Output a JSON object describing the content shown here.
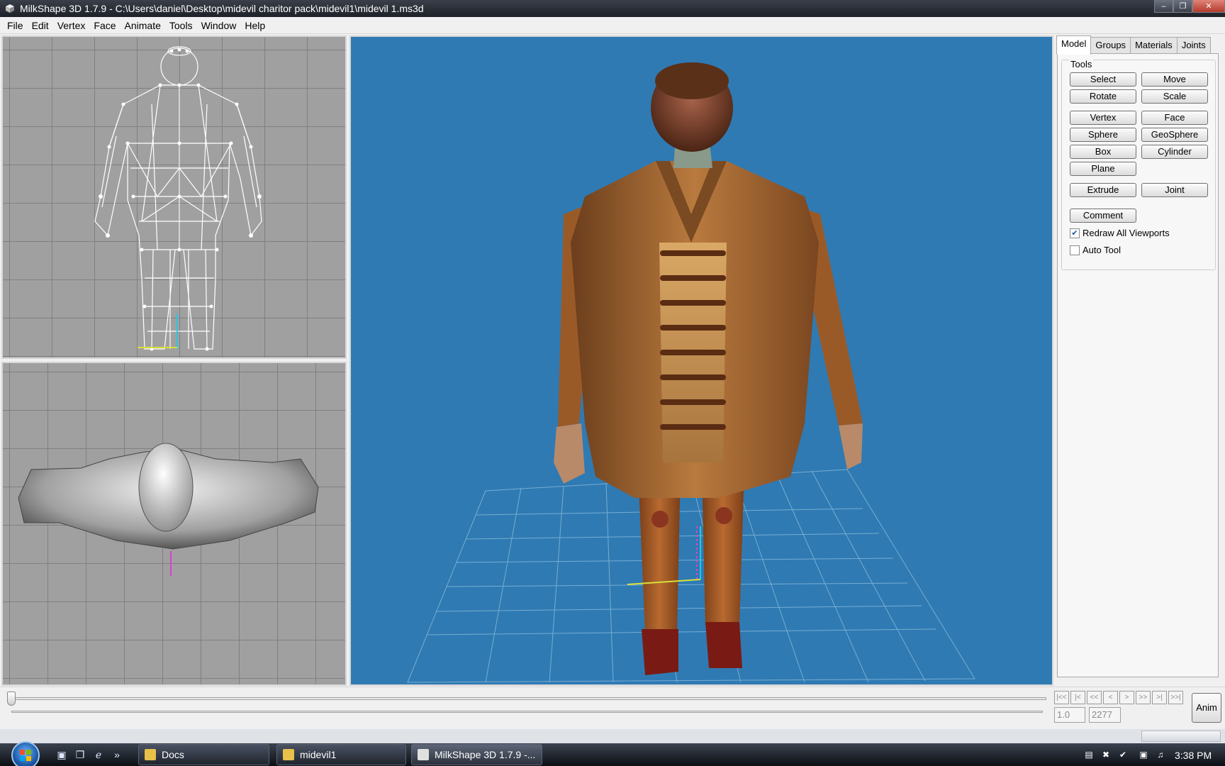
{
  "window": {
    "title": "MilkShape 3D 1.7.9 - C:\\Users\\daniel\\Desktop\\midevil charitor pack\\midevil1\\midevil 1.ms3d"
  },
  "menu": [
    "File",
    "Edit",
    "Vertex",
    "Face",
    "Animate",
    "Tools",
    "Window",
    "Help"
  ],
  "panel": {
    "tabs": [
      "Model",
      "Groups",
      "Materials",
      "Joints"
    ],
    "active_tab": "Model",
    "group_title": "Tools",
    "buttons": {
      "select": "Select",
      "move": "Move",
      "rotate": "Rotate",
      "scale": "Scale",
      "vertex": "Vertex",
      "face": "Face",
      "sphere": "Sphere",
      "geosphere": "GeoSphere",
      "box": "Box",
      "cylinder": "Cylinder",
      "plane": "Plane",
      "extrude": "Extrude",
      "joint": "Joint",
      "comment": "Comment"
    },
    "checks": {
      "redraw_label": "Redraw All Viewports",
      "redraw_checked": true,
      "autotool_label": "Auto Tool",
      "autotool_checked": false
    }
  },
  "timeline": {
    "start_frame": "1.0",
    "end_frame": "2277",
    "anim_label": "Anim",
    "nav_glyphs": [
      "|<<",
      "|<",
      "<<",
      "<",
      ">",
      ">>",
      ">|",
      ">>|"
    ]
  },
  "viewport_colors": {
    "ortho_bg": "#a0a0a0",
    "perspective_bg": "#2f7ab3"
  },
  "taskbar": {
    "quick_launch_overflow": "»",
    "items": [
      {
        "label": "Docs",
        "active": false
      },
      {
        "label": "midevil1",
        "active": false
      },
      {
        "label": "MilkShape 3D 1.7.9 -...",
        "active": true
      }
    ],
    "clock": "3:38 PM"
  }
}
